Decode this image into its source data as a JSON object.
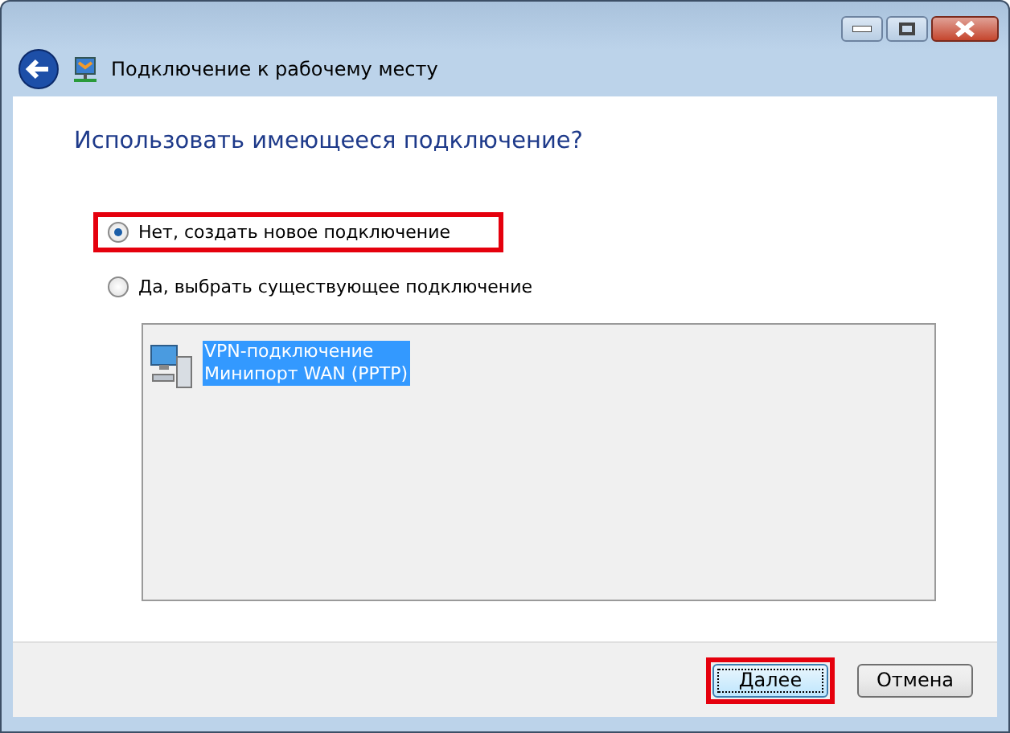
{
  "window": {
    "title": "Подключение к рабочему месту"
  },
  "heading": "Использовать имеющееся подключение?",
  "options": [
    {
      "label": "Нет, создать новое подключение",
      "selected": true,
      "highlighted": true
    },
    {
      "label": "Да, выбрать существующее подключение",
      "selected": false,
      "highlighted": false
    }
  ],
  "connections": [
    {
      "name": "VPN-подключение",
      "device": "Минипорт WAN (PPTP)",
      "selected": true
    }
  ],
  "buttons": [
    {
      "label": "Далее",
      "default": true,
      "highlighted": true
    },
    {
      "label": "Отмена",
      "default": false,
      "highlighted": false
    }
  ]
}
